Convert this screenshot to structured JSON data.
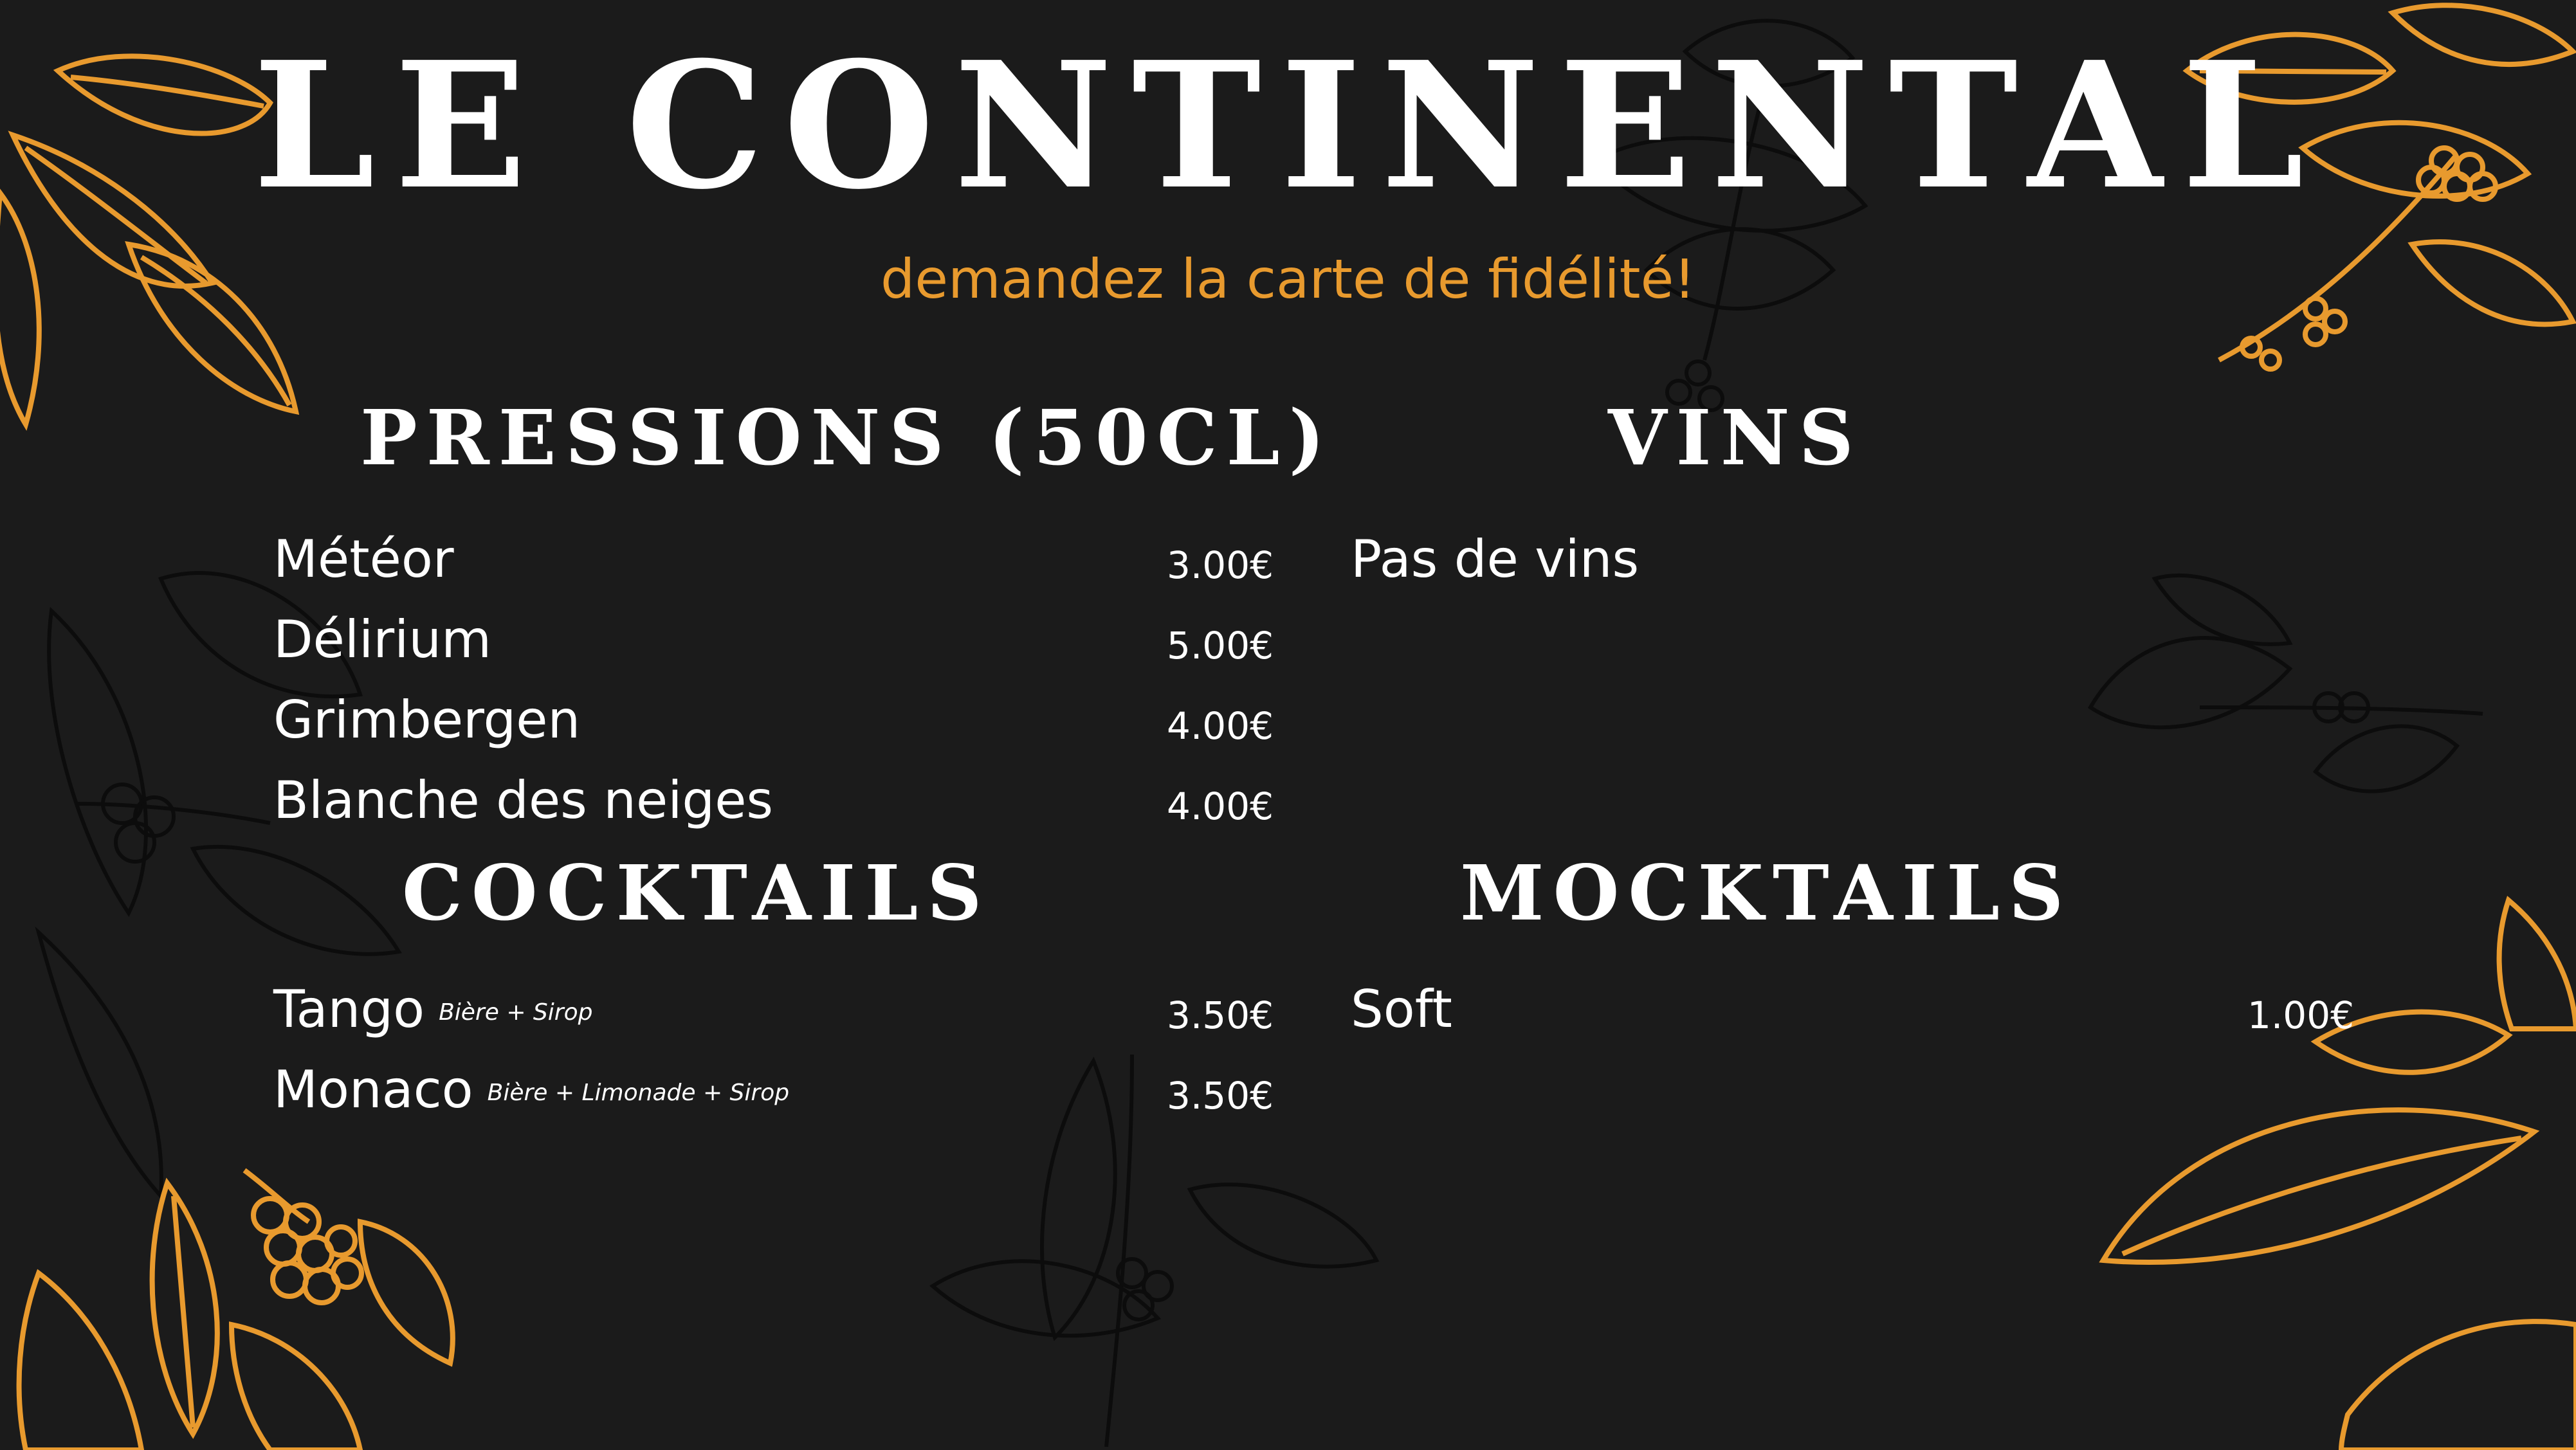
{
  "header": {
    "title": "LE CONTINENTAL",
    "subtitle": "demandez la carte de fidélité!"
  },
  "colors": {
    "background": "#1b1b1b",
    "accent": "#e89a2e",
    "text": "#ffffff",
    "decor_dark": "#0d0d0d"
  },
  "decorations": [
    "coffee-branch-illustration",
    "leaf-illustration"
  ],
  "sections": {
    "pressions": {
      "title": "PRESSIONS (50CL)",
      "items": [
        {
          "name": "Météor",
          "price": "3.00€"
        },
        {
          "name": "Délirium",
          "price": "5.00€"
        },
        {
          "name": "Grimbergen",
          "price": "4.00€"
        },
        {
          "name": "Blanche des neiges",
          "price": "4.00€"
        }
      ]
    },
    "vins": {
      "title": "VINS",
      "items": [
        {
          "name": "Pas de vins"
        }
      ]
    },
    "cocktails": {
      "title": "COCKTAILS",
      "items": [
        {
          "name": "Tango",
          "desc": "Bière + Sirop",
          "price": "3.50€"
        },
        {
          "name": "Monaco",
          "desc": "Bière + Limonade + Sirop",
          "price": "3.50€"
        }
      ]
    },
    "mocktails": {
      "title": "MOCKTAILS",
      "items": [
        {
          "name": "Soft",
          "price": "1.00€"
        }
      ]
    }
  }
}
